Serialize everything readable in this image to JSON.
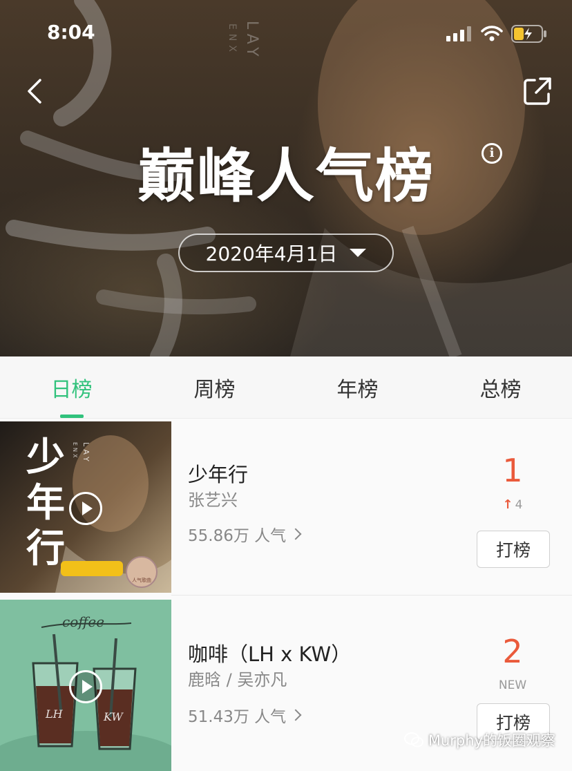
{
  "status_bar": {
    "time": "8:04"
  },
  "header": {
    "title": "巅峰人气榜",
    "info_icon": "info-icon",
    "date": "2020年4月1日",
    "back_icon": "chevron-left-icon",
    "share_icon": "share-icon",
    "bg_text": "LAY",
    "bg_text2": "ENX"
  },
  "tabs": [
    {
      "label": "日榜",
      "active": true
    },
    {
      "label": "周榜",
      "active": false
    },
    {
      "label": "年榜",
      "active": false
    },
    {
      "label": "总榜",
      "active": false
    }
  ],
  "songs": [
    {
      "title": "少年行",
      "artist": "张艺兴",
      "popularity": "55.86万 人气",
      "rank": "1",
      "change": "4",
      "vote_label": "打榜",
      "cover_text": "少年行",
      "cover_sub": "LAY",
      "cover_sub2": "ENX",
      "badge_text": "人气歌曲"
    },
    {
      "title": "咖啡（LH x KW）",
      "artist": "鹿晗 / 吴亦凡",
      "popularity": "51.43万 人气",
      "rank": "2",
      "change": "NEW",
      "vote_label": "打榜",
      "cover_text": "coffee",
      "cup_left": "LH",
      "cup_right": "KW"
    }
  ],
  "watermark": "Murphy的饭圈观察",
  "colors": {
    "accent_green": "#31c27c",
    "rank_red": "#ea5a3b"
  }
}
